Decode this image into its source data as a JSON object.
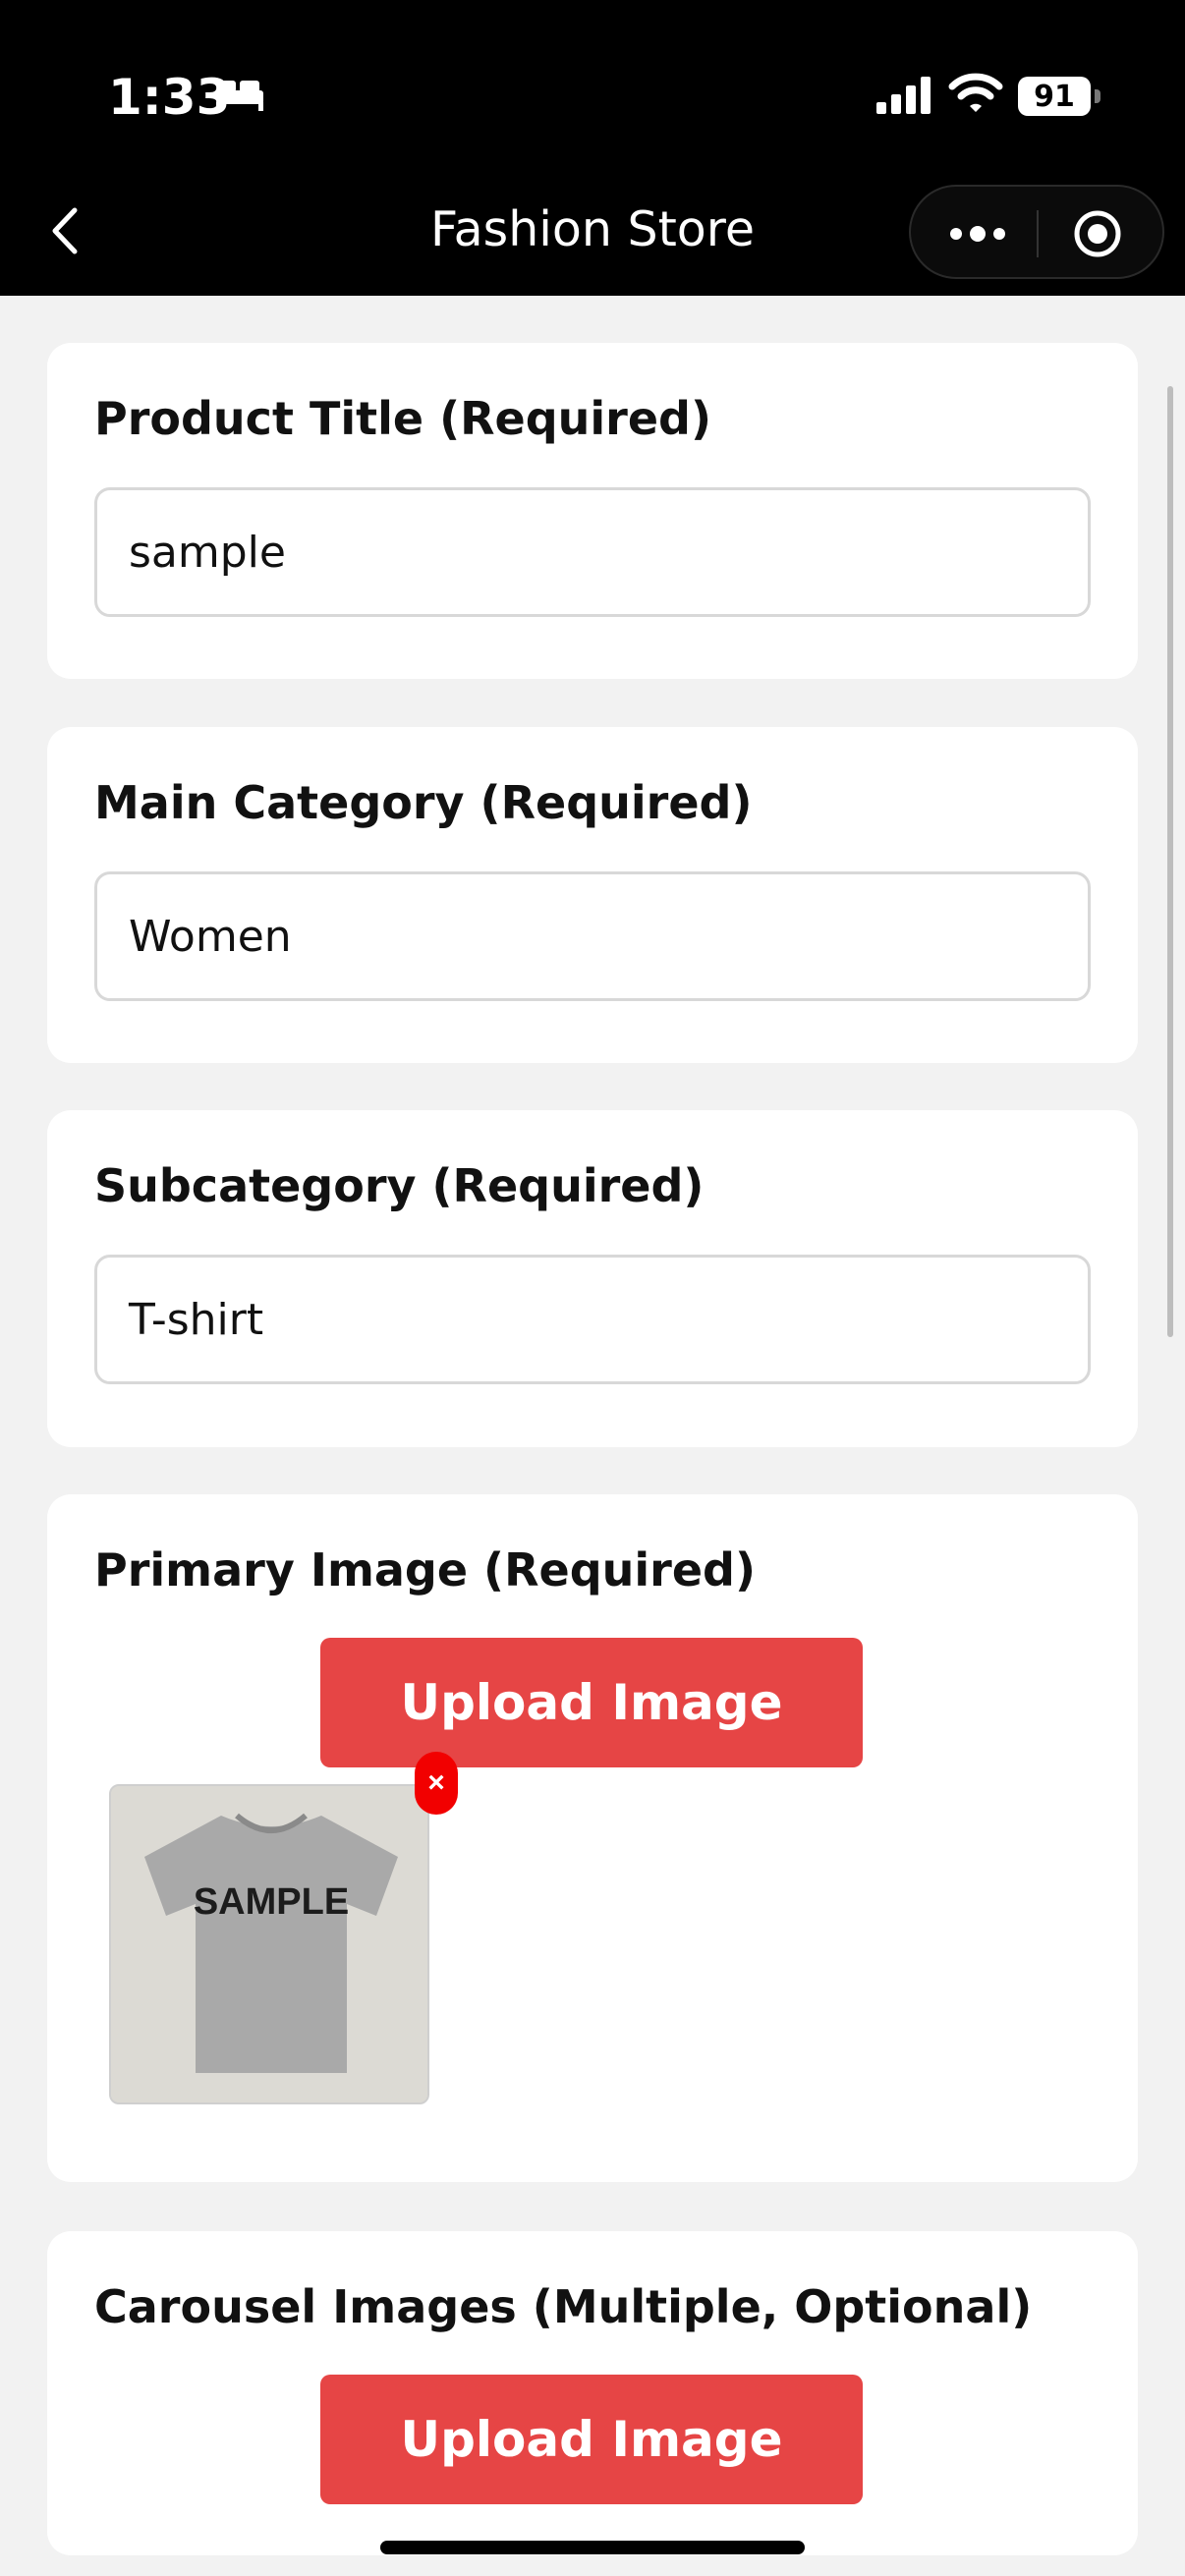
{
  "status_bar": {
    "time": "1:33",
    "battery": "91"
  },
  "nav": {
    "title": "Fashion Store"
  },
  "form": {
    "product_title": {
      "label": "Product Title (Required)",
      "value": "sample"
    },
    "main_category": {
      "label": "Main Category (Required)",
      "value": "Women"
    },
    "subcategory": {
      "label": "Subcategory (Required)",
      "value": "T-shirt"
    },
    "primary_image": {
      "label": "Primary Image (Required)",
      "upload_label": "Upload Image",
      "remove_label": "×",
      "thumb_text": "SAMPLE"
    },
    "carousel_images": {
      "label": "Carousel Images (Multiple, Optional)",
      "upload_label": "Upload Image"
    }
  },
  "colors": {
    "accent": "#e64545",
    "remove": "#f20000",
    "background": "#f2f2f2"
  }
}
